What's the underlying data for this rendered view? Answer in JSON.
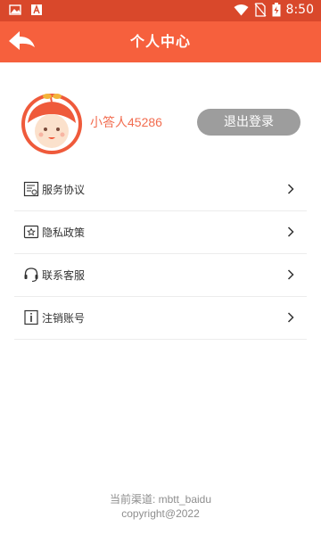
{
  "status_bar": {
    "time": "8:50",
    "left_icons": [
      "image-icon",
      "text-a-icon"
    ],
    "right_icons": [
      "wifi-icon",
      "no-sim-icon",
      "battery-icon"
    ]
  },
  "header": {
    "title": "个人中心",
    "back_icon": "back-arrow-icon",
    "color": "#f6603d"
  },
  "profile": {
    "username": "小答人45286",
    "logout_label": "退出登录",
    "avatar_icon": "baby-avatar-icon"
  },
  "menu": {
    "items": [
      {
        "label": "服务协议",
        "icon": "agreement-icon"
      },
      {
        "label": "隐私政策",
        "icon": "privacy-icon"
      },
      {
        "label": "联系客服",
        "icon": "headset-icon"
      },
      {
        "label": "注销账号",
        "icon": "info-icon"
      }
    ]
  },
  "footer": {
    "channel": "当前渠道: mbtt_baidu",
    "copyright": "copyright@2022"
  },
  "colors": {
    "accent": "#f6603d",
    "status_bar": "#d9482b",
    "username": "#f26c4f",
    "logout_button": "#9d9d9d",
    "footer_text": "#8e8e8e"
  }
}
